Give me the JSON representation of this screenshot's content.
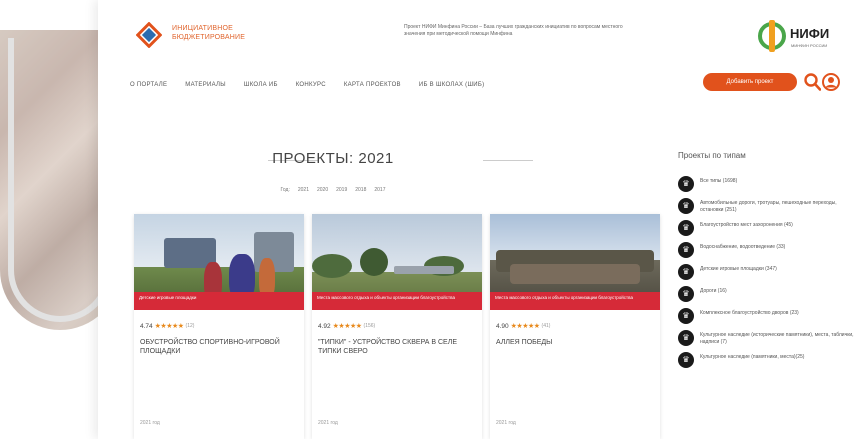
{
  "header": {
    "logo_text": "ИНИЦИАТИВНОЕ БЮДЖЕТИРОВАНИЕ",
    "blurb": "Проект НИФИ Минфина России – База лучших гражданских инициатив по вопросам местного значения при методической помощи Минфина",
    "partner_name": "НИФИ",
    "partner_sub": "Минфин России"
  },
  "nav": {
    "items": [
      "О ПОРТАЛЕ",
      "МАТЕРИАЛЫ",
      "ШКОЛА ИБ",
      "КОНКУРС",
      "КАРТА ПРОЕКТОВ",
      "ИБ В ШКОЛАХ (ШИБ)"
    ],
    "add_button": "Добавить проект"
  },
  "page": {
    "title": "ПРОЕКТЫ: 2021",
    "year_label": "Год:",
    "years": [
      "2021",
      "2020",
      "2019",
      "2018",
      "2017"
    ]
  },
  "cards": [
    {
      "category": "Детские игровые площадки",
      "rating": "4.74",
      "count": "(12)",
      "title": "ОБУСТРОЙСТВО СПОРТИВНО-ИГРОВОЙ ПЛОЩАДКИ",
      "year": "2021 год"
    },
    {
      "category": "Места массового отдыха и объекты организации благоустройства",
      "rating": "4.92",
      "count": "(156)",
      "title": "\"ТИПКИ\" - УСТРОЙСТВО СКВЕРА В СЕЛЕ ТИПКИ СВЕРО",
      "year": "2021 год"
    },
    {
      "category": "Места массового отдыха и объекты организации благоустройства",
      "rating": "4.90",
      "count": "(41)",
      "title": "АЛЛЕЯ ПОБЕДЫ",
      "year": "2021 год"
    }
  ],
  "sidebar": {
    "title": "Проекты по типам",
    "items": [
      "Все типы (1698)",
      "Автомобильные дороги, тротуары, пешеходные переходы, остановки (251)",
      "Благоустройство мест захоронения (45)",
      "Водоснабжение, водоотведение (33)",
      "Детские игровые площадки (347)",
      "Дороги (16)",
      "Комплексное благоустройство дворов (23)",
      "Культурное наследие (исторические памятники), места, таблички, надписи (7)",
      "Культурное наследие (памятники, места)(25)"
    ]
  },
  "colors": {
    "accent": "#e1521c",
    "category_bar": "#d62a38",
    "star": "#e88a1d",
    "partner_green": "#4aa64a",
    "partner_orange": "#f0a020"
  },
  "icons": {
    "search": "search-icon",
    "user": "user-icon",
    "sidebar": "trophy-icon"
  }
}
